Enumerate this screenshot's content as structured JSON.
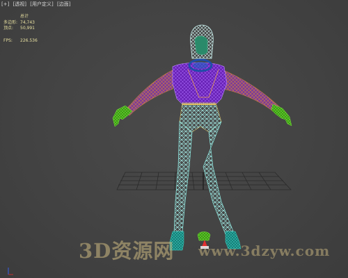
{
  "viewport": {
    "labels": [
      "[+]",
      "[透视]",
      "[用户定义]",
      "[边面]"
    ]
  },
  "stats": {
    "header": "总计",
    "rows": [
      {
        "label": "多边形:",
        "value": "74,743"
      },
      {
        "label": "顶点:",
        "value": "50,991"
      }
    ],
    "fps_label": "FPS:",
    "fps_value": "226.536"
  },
  "watermark": {
    "left": "3D资源网",
    "right": "www.3dzyw.com"
  },
  "colors": {
    "background": "#444444",
    "grid": "#2a2a2a",
    "torso": "#7a2fc8",
    "arms": "#b06a40",
    "hands": "#49b51c",
    "legs": "#8ce8e0",
    "helmet": "#c8f0ee",
    "face": "#2a8a6a",
    "neck_ring": "#1f4ea8",
    "boots": "#1c9c8c",
    "stats_text": "#e8e0a0"
  }
}
